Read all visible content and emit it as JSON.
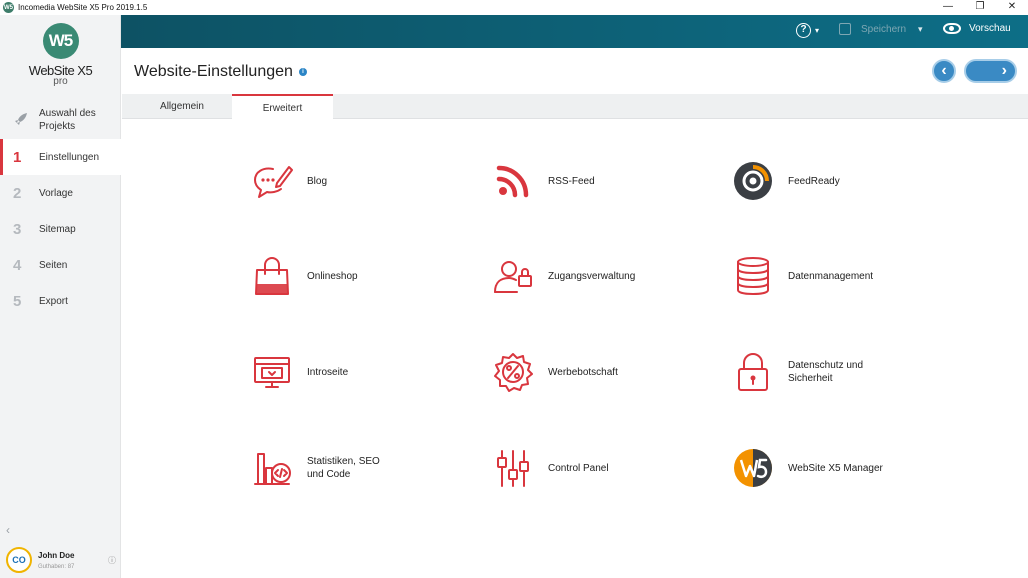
{
  "window": {
    "title": "Incomedia WebSite X5 Pro 2019.1.5",
    "app_icon": "W5",
    "controls": [
      "—",
      "❐",
      "✕"
    ]
  },
  "logo": {
    "mark": "W5",
    "name": "WebSite X5",
    "edition": "pro"
  },
  "sidebar": {
    "items": [
      {
        "num": "",
        "icon": "rocket-icon",
        "label": "Auswahl des Projekts"
      },
      {
        "num": "1",
        "label": "Einstellungen",
        "active": true
      },
      {
        "num": "2",
        "label": "Vorlage"
      },
      {
        "num": "3",
        "label": "Sitemap"
      },
      {
        "num": "4",
        "label": "Seiten"
      },
      {
        "num": "5",
        "label": "Export"
      }
    ],
    "collapse": "‹"
  },
  "user": {
    "name": "John Doe",
    "credit": "Guthaben: 87",
    "avatar": "CO"
  },
  "topbar": {
    "help": "?",
    "save_label": "Speichern",
    "preview_label": "Vorschau"
  },
  "header": {
    "title": "Website-Einstellungen",
    "info": "i",
    "back": "‹",
    "next": "›"
  },
  "tabs": {
    "general": "Allgemein",
    "advanced": "Erweitert"
  },
  "grid": {
    "blog": "Blog",
    "rss": "RSS-Feed",
    "feedready": "FeedReady",
    "shop": "Onlineshop",
    "access": "Zugangsverwaltung",
    "data": "Datenmanagement",
    "intro": "Introseite",
    "ad": "Werbebotschaft",
    "privacy": "Datenschutz und Sicherheit",
    "stats": "Statistiken, SEO und Code",
    "control": "Control Panel",
    "manager": "WebSite X5 Manager"
  },
  "colors": {
    "accent": "#d9363e",
    "topbar": "#0d6e87",
    "primary_button": "#3a8ac4",
    "sidebar": "#f2f3f4"
  }
}
